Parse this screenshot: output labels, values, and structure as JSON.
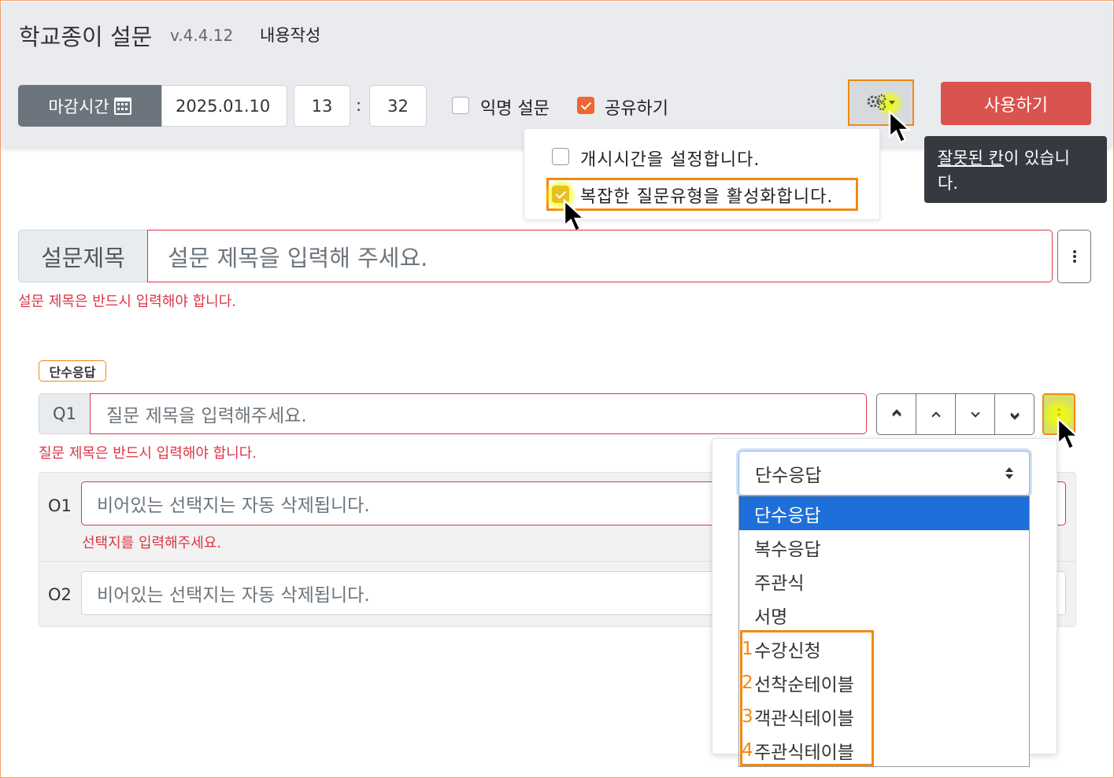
{
  "header": {
    "app_title": "학교종이 설문",
    "version": "v.4.4.12",
    "page_label": "내용작성"
  },
  "toolbar": {
    "deadline_label": "마감시간",
    "deadline_date": "2025.01.10",
    "deadline_hour": "13",
    "deadline_separator": ":",
    "deadline_minute": "32",
    "anonymous_label": "익명 설문",
    "anonymous_checked": false,
    "share_label": "공유하기",
    "share_checked": true,
    "use_button": "사용하기"
  },
  "settings_menu": {
    "items": [
      {
        "label": "개시시간을 설정합니다.",
        "checked": false
      },
      {
        "label": "복잡한 질문유형을 활성화합니다.",
        "checked": true
      }
    ]
  },
  "tooltip": {
    "underlined": "잘못된 칸",
    "rest": "이 있습니",
    "line2": "다."
  },
  "survey": {
    "title_label": "설문제목",
    "title_placeholder": "설문 제목을 입력해 주세요.",
    "title_error": "설문 제목은 반드시 입력해야 합니다."
  },
  "question": {
    "type_badge": "단수응답",
    "label": "Q1",
    "placeholder": "질문 제목을 입력해주세요.",
    "error": "질문 제목은 반드시 입력해야 합니다.",
    "options": [
      {
        "label": "O1",
        "placeholder": "비어있는 선택지는 자동 삭제됩니다.",
        "error": "선택지를 입력해주세요."
      },
      {
        "label": "O2",
        "placeholder": "비어있는 선택지는 자동 삭제됩니다.",
        "error": ""
      }
    ]
  },
  "type_menu": {
    "selected": "단수응답",
    "options": [
      {
        "num": "",
        "label": "단수응답"
      },
      {
        "num": "",
        "label": "복수응답"
      },
      {
        "num": "",
        "label": "주관식"
      },
      {
        "num": "",
        "label": "서명"
      },
      {
        "num": "1",
        "label": "수강신청"
      },
      {
        "num": "2",
        "label": "선착순테이블"
      },
      {
        "num": "3",
        "label": "객관식테이블"
      },
      {
        "num": "4",
        "label": "주관식테이블"
      }
    ]
  },
  "colors": {
    "accent_orange": "#f08a10",
    "danger": "#dc3545",
    "use_button": "#d9534f",
    "selected_blue": "#1e6fd9",
    "highlight_yellow": "#f0ff00"
  }
}
